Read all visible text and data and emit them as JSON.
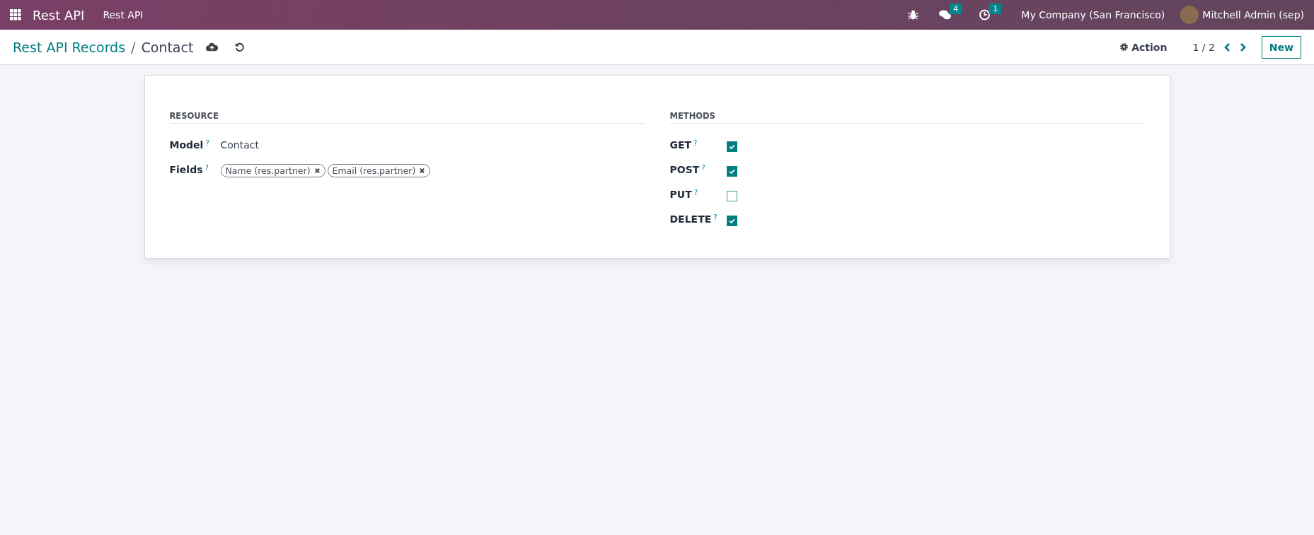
{
  "navbar": {
    "app_name": "Rest API",
    "menu": [
      "Rest API"
    ],
    "messages_badge": "4",
    "activities_badge": "1",
    "company": "My Company (San Francisco)",
    "user": "Mitchell Admin (sep)"
  },
  "control_panel": {
    "breadcrumb": "Rest API Records",
    "separator": "/",
    "current": "Contact",
    "action": "Action",
    "pager": "1 / 2",
    "new_button": "New"
  },
  "form": {
    "resource": {
      "title": "RESOURCE",
      "fields": [
        {
          "label": "Model",
          "help": "?",
          "kind": "text",
          "value": "Contact"
        },
        {
          "label": "Fields",
          "help": "?",
          "kind": "tags",
          "tags": [
            "Name (res.partner)",
            "Email (res.partner)"
          ]
        }
      ]
    },
    "methods": {
      "title": "METHODS",
      "items": [
        {
          "label": "GET",
          "help": "?",
          "checked": true
        },
        {
          "label": "POST",
          "help": "?",
          "checked": true
        },
        {
          "label": "PUT",
          "help": "?",
          "checked": false
        },
        {
          "label": "DELETE",
          "help": "?",
          "checked": true
        }
      ]
    }
  }
}
